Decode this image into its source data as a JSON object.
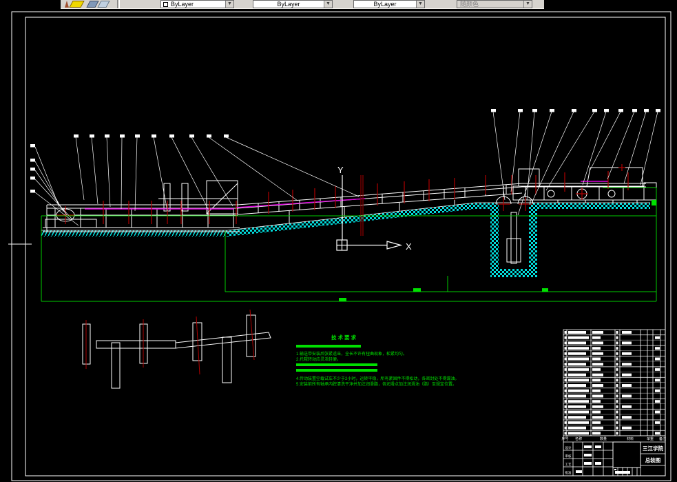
{
  "toolbar": {
    "color_control": "ByLayer",
    "linetype_control": "ByLayer",
    "lineweight_control": "ByLayer",
    "plot_style_control": "随颜色"
  },
  "drawing": {
    "ucs": {
      "x": "X",
      "y": "Y"
    },
    "notes": {
      "title": "技术要求",
      "line1": "1.输送带安装后张紧适当，全长不许有扭曲现象，松紧均匀。",
      "line2": "2.托辊转动应灵活轻便。",
      "line4": "4.传动装置空载试车不少于2小时，运转平稳，所有紧固件不得松动，各密封处不得漏油。",
      "line5": "5.安装前所有轴承内腔清洗干净并加注润滑脂，各润滑点加注润滑油（脂）至规定位置。"
    },
    "title_block": {
      "org": "三江学院",
      "drawing_name": "总装图",
      "bom_header": {
        "no": "序号",
        "name": "名称",
        "qty": "数量",
        "material": "材料",
        "weight": "单重",
        "remark": "备注"
      },
      "fields": {
        "design": "设计",
        "check": "审核",
        "process": "工艺",
        "approve": "批准"
      }
    },
    "colors": {
      "hatch_cyan": "#00dcdc",
      "dimension_green": "#00cc00",
      "note_green": "#00e000",
      "belt_magenta": "#dd00dd",
      "mark_red": "#b00000",
      "section_dark_red": "#7a0000",
      "linework_white": "#ffffff",
      "toolbar_gray": "#d6d3ce"
    }
  }
}
